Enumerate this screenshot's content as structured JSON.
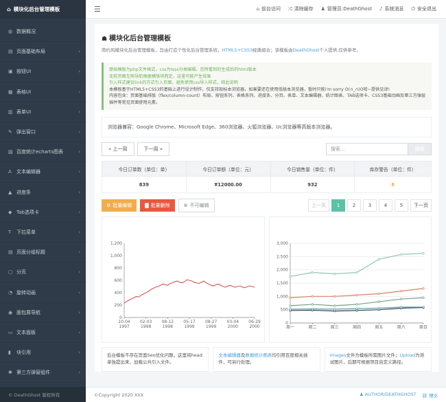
{
  "app": {
    "title": "模块化后台管理模板"
  },
  "sidebar": {
    "items": [
      {
        "icon": "dashboard-icon",
        "glyph": "◍",
        "label": "数据概况"
      },
      {
        "icon": "layout-icon",
        "glyph": "▤",
        "label": "页面基础布局"
      },
      {
        "icon": "button-icon",
        "glyph": "▣",
        "label": "按钮UI"
      },
      {
        "icon": "table-icon",
        "glyph": "▦",
        "label": "表格UI"
      },
      {
        "icon": "form-icon",
        "glyph": "▥",
        "label": "表单UI"
      },
      {
        "icon": "popup-icon",
        "glyph": "✎",
        "label": "弹出窗口"
      },
      {
        "icon": "chart-icon",
        "glyph": "▧",
        "label": "百度统计echarts图表"
      },
      {
        "icon": "editor-icon",
        "glyph": "A",
        "label": "文本编辑器"
      },
      {
        "icon": "progress-icon",
        "glyph": "▲",
        "label": "进度条"
      },
      {
        "icon": "tab-icon",
        "glyph": "◆",
        "label": "Tab选项卡"
      },
      {
        "icon": "dropdown-icon",
        "glyph": "T",
        "label": "下拉菜单"
      },
      {
        "icon": "pagination-icon",
        "glyph": "▤",
        "label": "页面分组标题"
      },
      {
        "icon": "page-icon",
        "glyph": "▢",
        "label": "分页"
      },
      {
        "icon": "animation-icon",
        "glyph": "◔",
        "label": "旋转动画"
      },
      {
        "icon": "breadcrumb-icon",
        "glyph": "◉",
        "label": "面包屑导航"
      },
      {
        "icon": "panel-icon",
        "glyph": "▭",
        "label": "文本面板"
      },
      {
        "icon": "quote-icon",
        "glyph": "▮",
        "label": "块引用"
      },
      {
        "icon": "plugin-icon",
        "glyph": "✱",
        "label": "第三方弹窗组件"
      }
    ],
    "footer": "© DeathGhost 版权所有"
  },
  "topbar": {
    "links": [
      {
        "icon": "home-icon",
        "glyph": "⌂",
        "label": "前台访问"
      },
      {
        "icon": "shuffle-icon",
        "glyph": "⤮",
        "label": "清除缓存"
      },
      {
        "icon": "user-icon",
        "glyph": "♟",
        "label": "管理员:DeathGhost"
      },
      {
        "icon": "bell-icon",
        "glyph": "♪",
        "label": "系统消息"
      },
      {
        "icon": "lock-icon",
        "glyph": "⏻",
        "label": "安全退出"
      }
    ]
  },
  "main": {
    "title": "模块化后台管理模板",
    "desc_a": "简约风模块化后台管理模板，旨由打造个性化后台管理系统，",
    "desc_b": "HTML5+CSS3",
    "desc_c": "经典组合；该模板由",
    "desc_d": "DeathGhost",
    "desc_e": "个人提供,仅供参考。",
    "notice": [
      {
        "text": "原始模板为php文件格式，css为less分类编辑，您所看到的生成后的html版本",
        "green": true
      },
      {
        "text": "无前页面左侧导航根据模版项而定，这里可能产生效果",
        "green": true
      },
      {
        "text": "引入样式建议link的方式引入页面，避免使用css导入样式，释此说明",
        "green": true
      },
      {
        "text": "本模板基于HTML5+CSS3的基础上进行设计制作，仅支持现标本浏览器，如果要还在使用低版本浏览器，暂时只能i'm sorry О(∩_∩)О哈~提供见谅!",
        "green": false
      },
      {
        "text": "内容包含：页面基础排版（flex/column-count）布局、按钮系列、表格系列、进度条、分页、表单、文本编辑器、统计图表、TAB选项卡、CSS3基础动画及第三方弹层插件等常见页面使用元素。",
        "green": false
      }
    ],
    "browsers": "浏览器兼容：Google Chrome、Microsoft Edge、360浏览器、火狐浏览器、Uc浏览器等高版本浏览器。",
    "prev_week": "« 上一周",
    "next_week": "下一周 »",
    "search_placeholder": "搜索...",
    "search_button": "搜索",
    "stats": {
      "headers": [
        "今日订单数（单位：单）",
        "今日订单额（单位：元）",
        "今日销售量（单位：件）",
        "库存警告（单位：件）"
      ],
      "values": [
        "839",
        "¥12000.00",
        "932",
        "8"
      ]
    },
    "actions": {
      "batch_edit": "批量编辑",
      "batch_delete": "批量删除",
      "readonly": "不可编辑"
    },
    "pager": {
      "prev": "上一页",
      "pages": [
        "1",
        "2",
        "3",
        "4",
        "5"
      ],
      "next": "下一页",
      "current": "1"
    },
    "info1": "后台模板不存在页面Seo优化问题，这里将head单独提出来，加载公共引入文件。",
    "info2_a": "文本编辑器",
    "info2_b": "及",
    "info2_c": "数据统计图表",
    "info2_d": "均引用百度相关插件，可另行处理。",
    "info3_a": "Images",
    "info3_b": "文件为模板所需图片文件；",
    "info3_c": "Upload",
    "info3_d": "为测试图片，后期可根据项目自定义路径。"
  },
  "footer": {
    "copyright": "©Copyright 2020 XXX",
    "author": "AUTHOR/DEATHGHOST",
    "link": "博文"
  },
  "chart_data": [
    {
      "type": "line",
      "title": "",
      "xlabel": "",
      "ylabel": "",
      "ylim": [
        0,
        1200
      ],
      "yticks": [
        0,
        200,
        400,
        600,
        800,
        1000,
        1200
      ],
      "xticks": [
        "10-04\n1997",
        "02-03\n1998",
        "08-12\n1998",
        "05-17\n1999",
        "08-27\n1999",
        "03-04\n2000",
        "06-29\n2000"
      ],
      "series": [
        {
          "color": "#c23531",
          "values": [
            230,
            260,
            280,
            300,
            320,
            340,
            330,
            360,
            380,
            400,
            420,
            450,
            470,
            490,
            500,
            520,
            540,
            530,
            520,
            550,
            560,
            580,
            590,
            570,
            560,
            580,
            610,
            600,
            590,
            570,
            560,
            550,
            570,
            590,
            560,
            540,
            520,
            510,
            530,
            540,
            520,
            500,
            490,
            510,
            520,
            500,
            490,
            500,
            510,
            490,
            480,
            500,
            510,
            500,
            490
          ]
        }
      ]
    },
    {
      "type": "line",
      "title": "",
      "ylim": [
        0,
        3000
      ],
      "yticks": [
        0,
        500,
        1000,
        1500,
        2000,
        2500,
        3000
      ],
      "categories": [
        "周一",
        "周二",
        "周三",
        "周四",
        "周五",
        "周六",
        "周日"
      ],
      "series": [
        {
          "color": "#91c7ae",
          "values": [
            1750,
            1900,
            1850,
            1900,
            2400,
            2580,
            2620
          ]
        },
        {
          "color": "#d48265",
          "values": [
            950,
            1000,
            1000,
            1050,
            1100,
            1200,
            1300
          ]
        },
        {
          "color": "#749f83",
          "values": [
            650,
            700,
            650,
            700,
            800,
            900,
            950
          ]
        },
        {
          "color": "#2f4554",
          "values": [
            470,
            480,
            450,
            470,
            500,
            560,
            580
          ]
        },
        {
          "color": "#61a0a8",
          "values": [
            520,
            530,
            520,
            540,
            560,
            600,
            600
          ]
        }
      ]
    }
  ]
}
